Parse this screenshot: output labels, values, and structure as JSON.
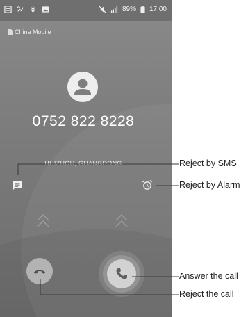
{
  "status_bar": {
    "battery": "89%",
    "time": "17:00",
    "left_icons": [
      "sim-card-icon",
      "missed-call-icon",
      "usb-icon",
      "image-icon"
    ],
    "right_icons": [
      "mute-icon",
      "signal-icon",
      "battery-icon"
    ]
  },
  "call": {
    "carrier": "China Mobile",
    "number": "0752 822 8228",
    "location": "HUIZHOU, GUANGDONG"
  },
  "callouts": {
    "reject_sms": "Reject by SMS",
    "reject_alarm": "Reject by Alarm",
    "answer": "Answer the call",
    "reject": "Reject the call"
  },
  "colors": {
    "background": "#7e7e7e",
    "answer_button": "#dedede",
    "reject_button": "#bdbdbd",
    "icon": "#5a5a5a"
  }
}
